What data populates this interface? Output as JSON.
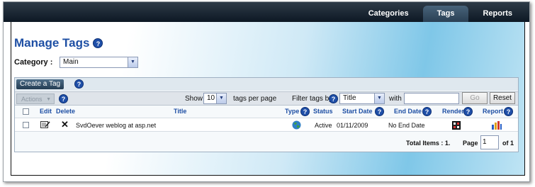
{
  "nav": {
    "tabs": [
      {
        "label": "Categories",
        "active": false
      },
      {
        "label": "Tags",
        "active": true
      },
      {
        "label": "Reports",
        "active": false
      }
    ]
  },
  "page": {
    "title": "Manage Tags",
    "help_glyph": "?"
  },
  "category": {
    "label": "Category :",
    "value": "Main"
  },
  "toolbar": {
    "create_label": "Create a Tag",
    "actions_label": "Actions",
    "show_label": "Show",
    "per_page_value": "10",
    "per_page_suffix": "tags per page",
    "filter_label": "Filter tags by",
    "filter_value": "Title",
    "with_label": "with",
    "search_value": "",
    "go_label": "Go",
    "reset_label": "Reset"
  },
  "table": {
    "headers": {
      "edit": "Edit",
      "delete": "Delete",
      "title": "Title",
      "type": "Type",
      "status": "Status",
      "start_date": "Start Date",
      "end_date": "End Date",
      "render": "Render",
      "report": "Report"
    },
    "rows": [
      {
        "title": "SvdOever weblog at asp.net",
        "status": "Active",
        "start_date": "01/11/2009",
        "end_date": "No End Date"
      }
    ]
  },
  "pagination": {
    "total_label": "Total Items : 1.",
    "page_label": "Page",
    "page_value": "1",
    "of_label": "of 1"
  },
  "colors": {
    "accent": "#1e4fa4",
    "topbar": "#1a2633"
  }
}
